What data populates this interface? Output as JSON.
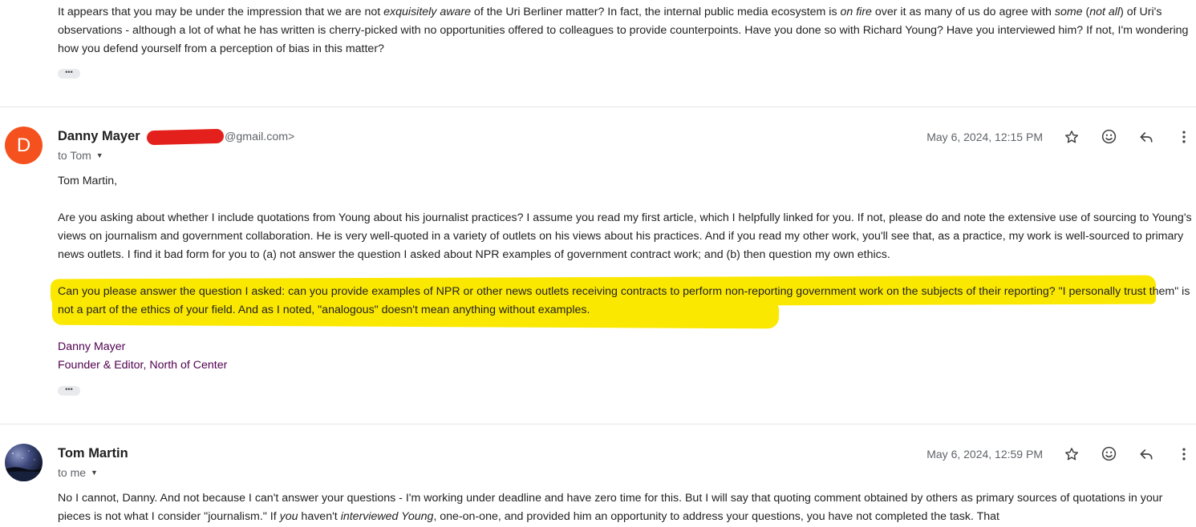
{
  "previous_message": {
    "body_parts": [
      {
        "text": "It appears that you may be under the impression that we are not ",
        "style": "normal"
      },
      {
        "text": "exquisitely aware",
        "style": "italic"
      },
      {
        "text": " of the Uri Berliner matter? In fact, the internal public media ecosystem is ",
        "style": "normal"
      },
      {
        "text": "on fire",
        "style": "italic"
      },
      {
        "text": " over it as many of us do agree with ",
        "style": "normal"
      },
      {
        "text": "some",
        "style": "italic"
      },
      {
        "text": " (",
        "style": "normal"
      },
      {
        "text": "not all",
        "style": "italic"
      },
      {
        "text": ") of Uri's observations - although a lot of what he has written is cherry-picked with no opportunities offered to colleagues to provide counterpoints. Have you done so with Richard Young? Have you interviewed him? If not, I'm wondering how you defend yourself from a perception of bias in this matter?",
        "style": "normal"
      }
    ],
    "more_label": "•••"
  },
  "message1": {
    "avatar_letter": "D",
    "avatar_color": "#f4511e",
    "sender_name": "Danny Mayer",
    "sender_email_suffix": "@gmail.com>",
    "to_label": "to Tom",
    "date": "May 6, 2024, 12:15 PM",
    "greeting": "Tom Martin,",
    "paragraph1": "Are you asking about whether I include quotations from Young about his journalist practices?  I assume you read my first article, which I helpfully linked for you. If not, please do and note the extensive use of sourcing to Young's views on journalism and government collaboration.  He is very well-quoted in a variety of outlets on his views about his practices. And if you read my other work, you'll see that, as a practice, my work is well-sourced to primary news outlets. I find it bad form for you to (a) not answer the question I asked about NPR examples of government contract work; and (b) then question my own ethics.",
    "paragraph2": "Can you please answer the question I asked: can you provide examples of NPR or other news outlets receiving contracts to perform non-reporting government work on the subjects of their reporting?  \"I personally trust them\" is not a part of the ethics of your field.  And as I noted, \"analogous\" doesn't mean anything without examples.",
    "highlight_color": "#fbe800",
    "signature_name": "Danny Mayer",
    "signature_title": "Founder & Editor, North of Center",
    "more_label": "•••"
  },
  "message2": {
    "sender_name": "Tom Martin",
    "to_label": "to me",
    "date": "May 6, 2024, 12:59 PM",
    "body_parts": [
      {
        "text": "No I cannot, Danny. And not because I can't answer your questions - I'm working under deadline and have zero time for this. But I will say that quoting comment obtained by others as primary sources of quotations in your pieces is not what I consider \"journalism.\" If ",
        "style": "normal"
      },
      {
        "text": "you",
        "style": "italic"
      },
      {
        "text": " haven't ",
        "style": "normal"
      },
      {
        "text": "interviewed Young",
        "style": "italic"
      },
      {
        "text": ", one-on-one, and provided him an opportunity to address your questions, you have not completed the task. That",
        "style": "normal"
      }
    ]
  },
  "icons": {
    "star": "star-icon",
    "emoji": "emoji-icon",
    "reply": "reply-icon",
    "more": "more-vert-icon",
    "caret": "caret-down-icon"
  }
}
